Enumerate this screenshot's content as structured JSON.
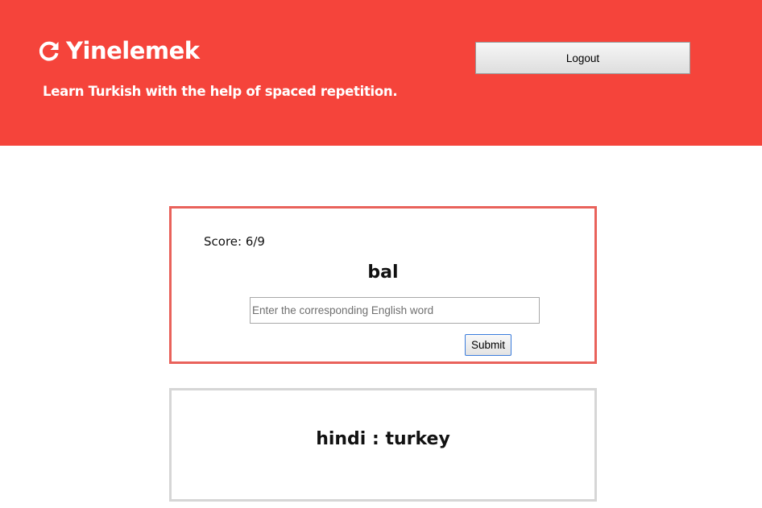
{
  "header": {
    "brand_icon": "refresh-icon",
    "app_title": "Yinelemek",
    "tagline": "Learn Turkish with the help of spaced repetition.",
    "logout_label": "Logout",
    "background_color": "#f5443b"
  },
  "quiz": {
    "score_text": "Score: 6/9",
    "word": "bal",
    "answer": {
      "value": "",
      "placeholder": "Enter the corresponding English word"
    },
    "submit_label": "Submit",
    "border_color": "#e9625b"
  },
  "result": {
    "text": "hindi : turkey",
    "border_color": "#d6d6d6"
  }
}
